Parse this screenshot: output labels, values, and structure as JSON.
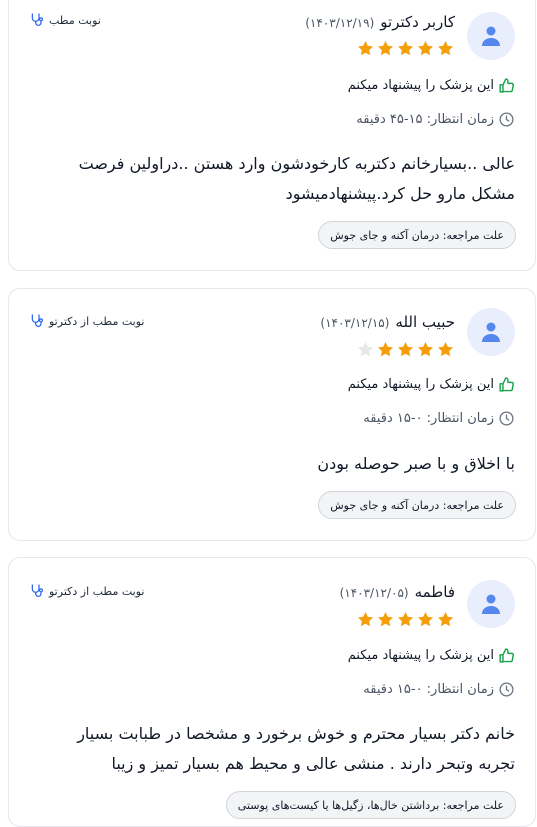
{
  "colors": {
    "star": "#f59e0b",
    "star_empty": "#e5e7eb",
    "thumb": "#16a34a",
    "accent": "#2563eb",
    "avatar_bg": "#e8eefc"
  },
  "reviews": [
    {
      "name": "کاربر دکترتو",
      "date": "(۱۴۰۳/۱۲/۱۹)",
      "rating": 5,
      "visit_label": "نوبت مطب",
      "recommend_text": "این پزشک را پیشنهاد میکنم",
      "wait_text": "زمان انتظار: ۱۵-۴۵ دقیقه",
      "comment": "عالی ..بسیارخانم دکتربه کارخودشون وارد هستن ..دراولین فرصت مشکل مارو حل کرد.پیشنهادمیشود",
      "reason": "علت مراجعه:  درمان آکنه و جای جوش"
    },
    {
      "name": "حبیب الله",
      "date": "(۱۴۰۳/۱۲/۱۵)",
      "rating": 4,
      "visit_label": "نوبت مطب از دکترتو",
      "recommend_text": "این پزشک را پیشنهاد میکنم",
      "wait_text": "زمان انتظار: ۰-۱۵ دقیقه",
      "comment": "با اخلاق و با صبر حوصله بودن",
      "reason": "علت مراجعه:  درمان آکنه و جای جوش"
    },
    {
      "name": "فاطمه",
      "date": "(۱۴۰۳/۱۲/۰۵)",
      "rating": 5,
      "visit_label": "نوبت مطب از دکترتو",
      "recommend_text": "این پزشک را پیشنهاد میکنم",
      "wait_text": "زمان انتظار: ۰-۱۵ دقیقه",
      "comment": "خانم دکتر بسیار محترم و خوش برخورد و مشخصا در طبابت بسیار تجربه وتبحر دارند . منشی عالی و محیط هم بسیار تمیز و زیبا",
      "reason": "علت مراجعه:  برداشتن خال‌ها، زگیل‌ها یا کیست‌های پوستی"
    }
  ]
}
